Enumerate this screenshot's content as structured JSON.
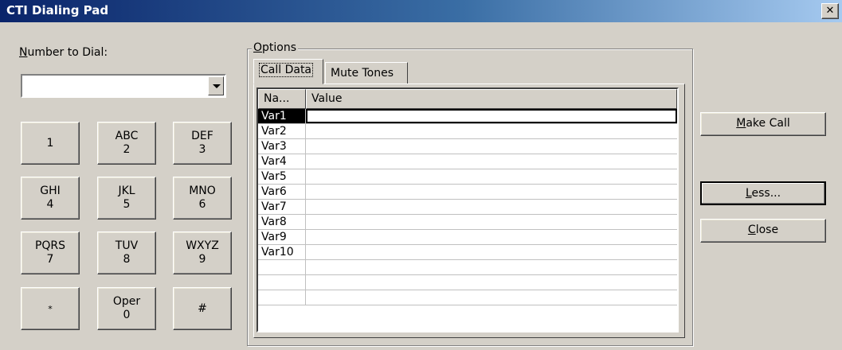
{
  "window": {
    "title": "CTI Dialing Pad"
  },
  "dial": {
    "label_prefix": "N",
    "label_rest": "umber to Dial:",
    "value": ""
  },
  "keypad": [
    {
      "letters": "",
      "digit": "1"
    },
    {
      "letters": "ABC",
      "digit": "2"
    },
    {
      "letters": "DEF",
      "digit": "3"
    },
    {
      "letters": "GHI",
      "digit": "4"
    },
    {
      "letters": "JKL",
      "digit": "5"
    },
    {
      "letters": "MNO",
      "digit": "6"
    },
    {
      "letters": "PQRS",
      "digit": "7"
    },
    {
      "letters": "TUV",
      "digit": "8"
    },
    {
      "letters": "WXYZ",
      "digit": "9"
    },
    {
      "letters": "",
      "digit": "*"
    },
    {
      "letters": "Oper",
      "digit": "0"
    },
    {
      "letters": "",
      "digit": "#"
    }
  ],
  "options": {
    "legend_prefix": "O",
    "legend_rest": "ptions",
    "tabs": [
      {
        "label": "Call Data"
      },
      {
        "label": "Mute Tones"
      }
    ],
    "columns": [
      "Na...",
      "Value"
    ],
    "rows": [
      {
        "name": "Var1",
        "value": ""
      },
      {
        "name": "Var2",
        "value": ""
      },
      {
        "name": "Var3",
        "value": ""
      },
      {
        "name": "Var4",
        "value": ""
      },
      {
        "name": "Var5",
        "value": ""
      },
      {
        "name": "Var6",
        "value": ""
      },
      {
        "name": "Var7",
        "value": ""
      },
      {
        "name": "Var8",
        "value": ""
      },
      {
        "name": "Var9",
        "value": ""
      },
      {
        "name": "Var10",
        "value": ""
      },
      {
        "name": "",
        "value": ""
      },
      {
        "name": "",
        "value": ""
      },
      {
        "name": "",
        "value": ""
      }
    ]
  },
  "buttons": {
    "make_call": {
      "prefix": "M",
      "rest": "ake Call"
    },
    "less": {
      "prefix": "L",
      "rest": "ess..."
    },
    "close": {
      "prefix": "C",
      "rest": "lose"
    }
  },
  "icons": {
    "close": "close-icon",
    "dropdown": "chevron-down-icon"
  }
}
